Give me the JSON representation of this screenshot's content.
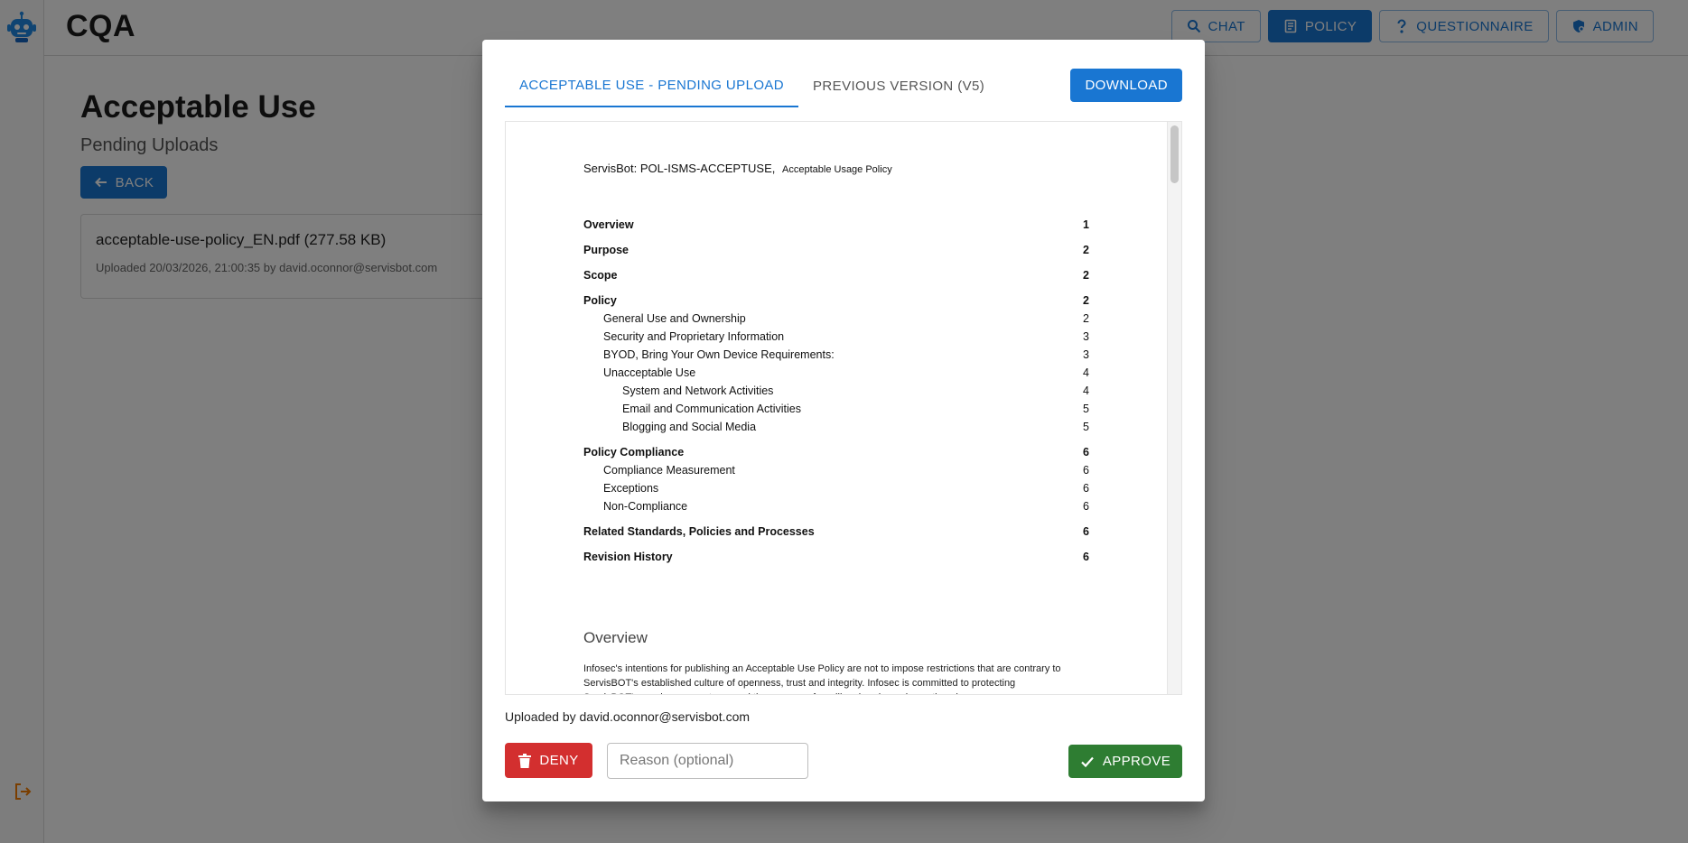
{
  "app": {
    "brand": "CQA"
  },
  "header": {
    "nav": [
      {
        "label": "CHAT",
        "icon": "search-icon",
        "active": false
      },
      {
        "label": "POLICY",
        "icon": "document-icon",
        "active": true
      },
      {
        "label": "QUESTIONNAIRE",
        "icon": "question-icon",
        "active": false
      },
      {
        "label": "ADMIN",
        "icon": "admin-shield-icon",
        "active": false
      }
    ]
  },
  "page": {
    "title": "Acceptable Use",
    "subtitle": "Pending Uploads",
    "back_label": "BACK",
    "upload": {
      "filename": "acceptable-use-policy_EN.pdf (277.58 KB)",
      "meta": "Uploaded 20/03/2026, 21:00:35 by david.oconnor@servisbot.com"
    }
  },
  "modal": {
    "tabs": [
      {
        "label": "ACCEPTABLE USE - PENDING UPLOAD",
        "active": true
      },
      {
        "label": "PREVIOUS VERSION (V5)",
        "active": false
      }
    ],
    "download_label": "DOWNLOAD",
    "document": {
      "header_main": "ServisBot: POL-ISMS-ACCEPTUSE,",
      "header_sub": "Acceptable Usage Policy",
      "toc": [
        {
          "title": "Overview",
          "page": "1",
          "level": 1
        },
        {
          "title": "Purpose",
          "page": "2",
          "level": 1
        },
        {
          "title": "Scope",
          "page": "2",
          "level": 1
        },
        {
          "title": "Policy",
          "page": "2",
          "level": 1
        },
        {
          "title": "General Use and Ownership",
          "page": "2",
          "level": 2
        },
        {
          "title": "Security and Proprietary Information",
          "page": "3",
          "level": 2
        },
        {
          "title": "BYOD, Bring Your Own Device Requirements:",
          "page": "3",
          "level": 2
        },
        {
          "title": "Unacceptable Use",
          "page": "4",
          "level": 2
        },
        {
          "title": "System and Network Activities",
          "page": "4",
          "level": 3
        },
        {
          "title": "Email and Communication Activities",
          "page": "5",
          "level": 3
        },
        {
          "title": "Blogging and Social Media",
          "page": "5",
          "level": 3
        },
        {
          "title": "Policy Compliance",
          "page": "6",
          "level": 1
        },
        {
          "title": "Compliance Measurement",
          "page": "6",
          "level": 2
        },
        {
          "title": "Exceptions",
          "page": "6",
          "level": 2
        },
        {
          "title": "Non-Compliance",
          "page": "6",
          "level": 2
        },
        {
          "title": "Related Standards, Policies and Processes",
          "page": "6",
          "level": 1
        },
        {
          "title": "Revision History",
          "page": "6",
          "level": 1
        }
      ],
      "section_title": "Overview",
      "paragraph": "Infosec's intentions for publishing an Acceptable Use Policy are not to impose restrictions that are contrary to ServisBOT's established culture of openness, trust and integrity. Infosec is committed to protecting ServisBOT's employees, partners and the company from illegal or damaging actions by"
    },
    "uploaded_by": "Uploaded by david.oconnor@servisbot.com",
    "deny_label": "DENY",
    "reason_placeholder": "Reason (optional)",
    "reason_value": "",
    "approve_label": "APPROVE"
  },
  "colors": {
    "primary": "#1976d2",
    "deny": "#d32f2f",
    "approve": "#2e7d32",
    "logo": "#1e88e5",
    "logout_icon": "#f57c00"
  }
}
